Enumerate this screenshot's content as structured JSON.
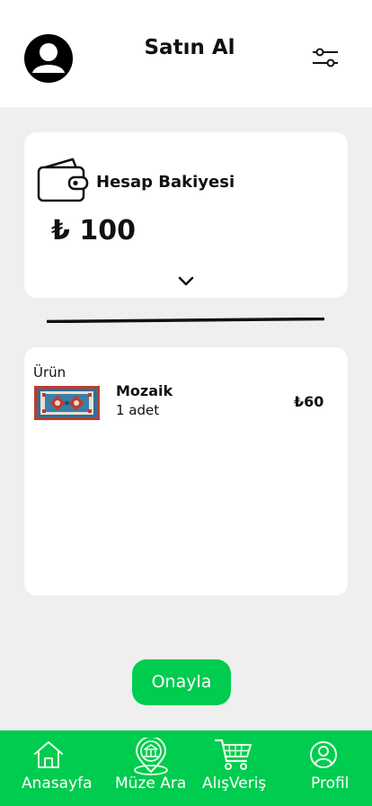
{
  "header": {
    "title": "Satın Al",
    "profile_icon": "user-avatar-icon",
    "filter_icon": "sliders-icon"
  },
  "balance": {
    "label": "Hesap Bakiyesi",
    "value": "₺ 100",
    "icon": "wallet-icon",
    "expand_icon": "chevron-down-icon"
  },
  "cart": {
    "column_label": "Ürün",
    "items": [
      {
        "name": "Mozaik",
        "quantity": "1 adet",
        "price": "₺60",
        "image": "mosaic-carpet-thumbnail"
      }
    ]
  },
  "actions": {
    "confirm_label": "Onayla"
  },
  "nav": {
    "items": [
      {
        "label": "Anasayfa",
        "icon": "home-icon"
      },
      {
        "label": "Müze Ara",
        "icon": "museum-location-icon"
      },
      {
        "label": "AlışVeriş",
        "icon": "shopping-cart-icon"
      },
      {
        "label": "Profil",
        "icon": "profile-icon"
      }
    ]
  },
  "colors": {
    "accent": "#00cc4f",
    "background": "#efefef",
    "card": "#ffffff"
  }
}
